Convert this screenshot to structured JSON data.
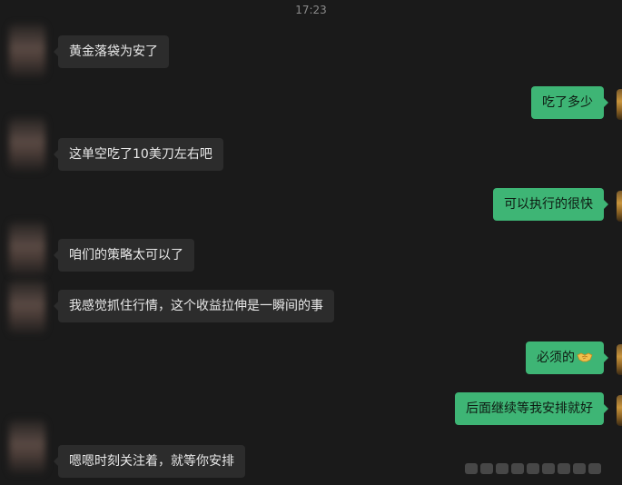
{
  "timestamp": "17:23",
  "messages": [
    {
      "side": "left",
      "text": "黄金落袋为安了"
    },
    {
      "side": "right",
      "text": "吃了多少"
    },
    {
      "side": "left",
      "text": "这单空吃了10美刀左右吧"
    },
    {
      "side": "right",
      "text": "可以执行的很快"
    },
    {
      "side": "left",
      "text": "咱们的策略太可以了"
    },
    {
      "side": "left",
      "text": "我感觉抓住行情，这个收益拉伸是一瞬间的事"
    },
    {
      "side": "right",
      "text": "必须的",
      "emoji": "handshake-icon"
    },
    {
      "side": "right",
      "text": "后面继续等我安排就好"
    },
    {
      "side": "left",
      "text": "嗯嗯时刻关注着，就等你安排"
    }
  ],
  "colors": {
    "background": "#1a1a1a",
    "bubble_left": "#2c2c2c",
    "bubble_right": "#3eb575",
    "text_left": "#e8e8e8",
    "text_right": "#0e1a12",
    "timestamp": "#8a8a8a"
  }
}
